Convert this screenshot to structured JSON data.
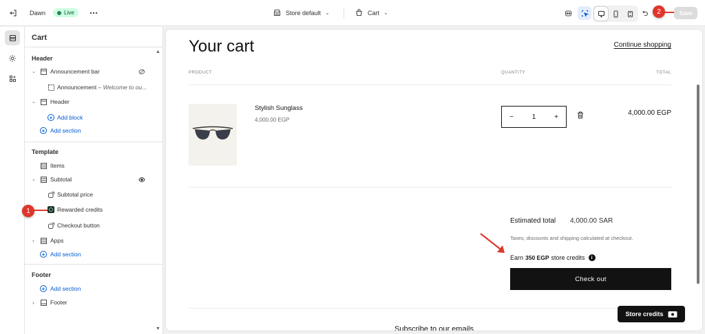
{
  "topbar": {
    "exit_icon": "exit-icon",
    "theme_name": "Dawn",
    "live_badge": "Live",
    "more_icon": "more-horizontal-icon",
    "store_select": "Store default",
    "page_select": "Cart",
    "save_label": "Save"
  },
  "callouts": {
    "one": "1",
    "two": "2"
  },
  "sidebar": {
    "title": "Cart",
    "header_group": {
      "title": "Header",
      "announcement_bar": "Announcement bar",
      "announcement_block": "Announcement",
      "announcement_sub": " – Welcome to ou...",
      "header": "Header",
      "add_block": "Add block",
      "add_section": "Add section"
    },
    "template_group": {
      "title": "Template",
      "items": "Items",
      "subtotal": "Subtotal",
      "subtotal_price": "Subtotal price",
      "rewarded_credits": "Rewarded credits",
      "checkout_button": "Checkout button",
      "apps": "Apps",
      "add_section": "Add section"
    },
    "footer_group": {
      "title": "Footer",
      "add_section": "Add section",
      "footer": "Footer"
    }
  },
  "preview": {
    "title": "Your cart",
    "continue": "Continue shopping",
    "col_product": "PRODUCT",
    "col_quantity": "QUANTITY",
    "col_total": "TOTAL",
    "product": {
      "name": "Stylish Sunglass",
      "price": "4,000.00 EGP",
      "quantity": "1",
      "line_total": "4,000.00 EGP"
    },
    "qty_minus": "−",
    "qty_plus": "+",
    "estimated_label": "Estimated total",
    "estimated_value": "4,000.00 SAR",
    "tax_note": "Taxes, discounts and shipping calculated at checkout.",
    "earn_prefix": "Earn",
    "earn_amount": "350 EGP",
    "earn_suffix": "store credits",
    "info_glyph": "i",
    "checkout_label": "Check out",
    "store_credits_label": "Store credits",
    "subscribe_heading": "Subscribe to our emails"
  },
  "colors": {
    "accent_link": "#005bd3",
    "live_badge_bg": "#cdfee1",
    "callout_red": "#e0352b",
    "button_dark": "#121212"
  }
}
